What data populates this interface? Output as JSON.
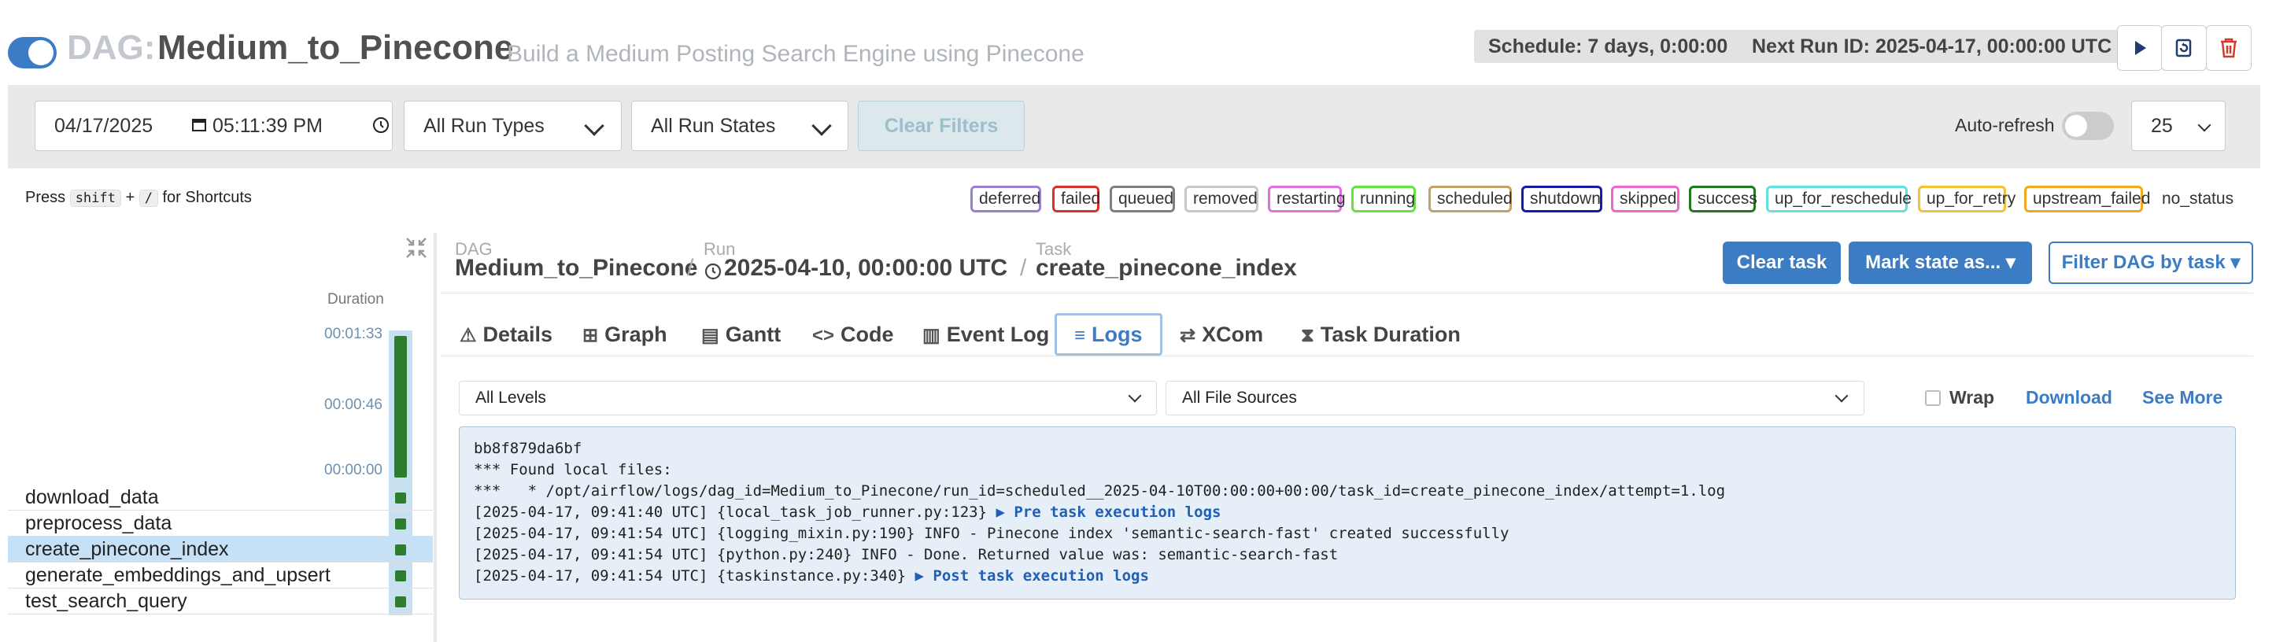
{
  "header": {
    "dag_prefix": "DAG:",
    "dag_id": "Medium_to_Pinecone",
    "description": "Build a Medium Posting Search Engine using Pinecone",
    "schedule": "Schedule: 7 days, 0:00:00",
    "next_run": "Next Run ID: 2025-04-17, 00:00:00 UTC",
    "dag_enabled": true,
    "action_icons": [
      "play-icon",
      "refresh-icon",
      "trash-icon"
    ]
  },
  "filters": {
    "date": "04/17/2025",
    "time": "05:11:39 PM",
    "run_types": "All Run Types",
    "run_states": "All Run States",
    "clear_filters": "Clear Filters",
    "auto_refresh_label": "Auto-refresh",
    "auto_refresh_on": false,
    "page_size": "25"
  },
  "shortcuts": {
    "press": "Press",
    "key1": "shift",
    "plus": "+",
    "key2": "/",
    "suffix": "for Shortcuts"
  },
  "legend": [
    {
      "label": "deferred",
      "color": "#9b7fd4"
    },
    {
      "label": "failed",
      "color": "#d9322b"
    },
    {
      "label": "queued",
      "color": "#808080"
    },
    {
      "label": "removed",
      "color": "#c8c8c8"
    },
    {
      "label": "restarting",
      "color": "#e26ee2"
    },
    {
      "label": "running",
      "color": "#62e33f"
    },
    {
      "label": "scheduled",
      "color": "#c4a36a"
    },
    {
      "label": "shutdown",
      "color": "#1a1aa8"
    },
    {
      "label": "skipped",
      "color": "#ee66c8"
    },
    {
      "label": "success",
      "color": "#1f7a1f"
    },
    {
      "label": "up_for_reschedule",
      "color": "#63e0e0"
    },
    {
      "label": "up_for_retry",
      "color": "#f2c232"
    },
    {
      "label": "upstream_failed",
      "color": "#f5a623"
    },
    {
      "label": "no_status",
      "color": "#ffffff"
    }
  ],
  "grid": {
    "duration_header": "Duration",
    "ticks": [
      "00:01:33",
      "00:00:46",
      "00:00:00"
    ],
    "tasks": [
      {
        "name": "download_data",
        "selected": false
      },
      {
        "name": "preprocess_data",
        "selected": false
      },
      {
        "name": "create_pinecone_index",
        "selected": true
      },
      {
        "name": "generate_embeddings_and_upsert",
        "selected": false
      },
      {
        "name": "test_search_query",
        "selected": false
      }
    ]
  },
  "breadcrumb": {
    "dag_label": "DAG",
    "dag_value": "Medium_to_Pinecone",
    "run_label": "Run",
    "run_value": "2025-04-10, 00:00:00 UTC",
    "task_label": "Task",
    "task_value": "create_pinecone_index",
    "sep": "/"
  },
  "actions": {
    "clear_task": "Clear task",
    "mark_state": "Mark state as... ▾",
    "filter_dag": "Filter DAG by task ▾"
  },
  "tabs": [
    {
      "label": "Details",
      "icon": "⚠"
    },
    {
      "label": "Graph",
      "icon": "⊞"
    },
    {
      "label": "Gantt",
      "icon": "▤"
    },
    {
      "label": "Code",
      "icon": "<>"
    },
    {
      "label": "Event Log",
      "icon": "▥"
    },
    {
      "label": "Logs",
      "icon": "≡",
      "active": true
    },
    {
      "label": "XCom",
      "icon": "⇄"
    },
    {
      "label": "Task Duration",
      "icon": "⧗"
    }
  ],
  "log_controls": {
    "levels": "All Levels",
    "sources": "All File Sources",
    "wrap": "Wrap",
    "download": "Download",
    "see_more": "See More"
  },
  "log_lines": [
    {
      "text": "bb8f879da6bf"
    },
    {
      "text": "*** Found local files:"
    },
    {
      "text": "***   * /opt/airflow/logs/dag_id=Medium_to_Pinecone/run_id=scheduled__2025-04-10T00:00:00+00:00/task_id=create_pinecone_index/attempt=1.log"
    },
    {
      "text": "[2025-04-17, 09:41:40 UTC] {local_task_job_runner.py:123} ",
      "link": "▶ Pre task execution logs"
    },
    {
      "text": "[2025-04-17, 09:41:54 UTC] {logging_mixin.py:190} INFO - Pinecone index 'semantic-search-fast' created successfully"
    },
    {
      "text": "[2025-04-17, 09:41:54 UTC] {python.py:240} INFO - Done. Returned value was: semantic-search-fast"
    },
    {
      "text": "[2025-04-17, 09:41:54 UTC] {taskinstance.py:340} ",
      "link": "▶ Post task execution logs"
    }
  ]
}
